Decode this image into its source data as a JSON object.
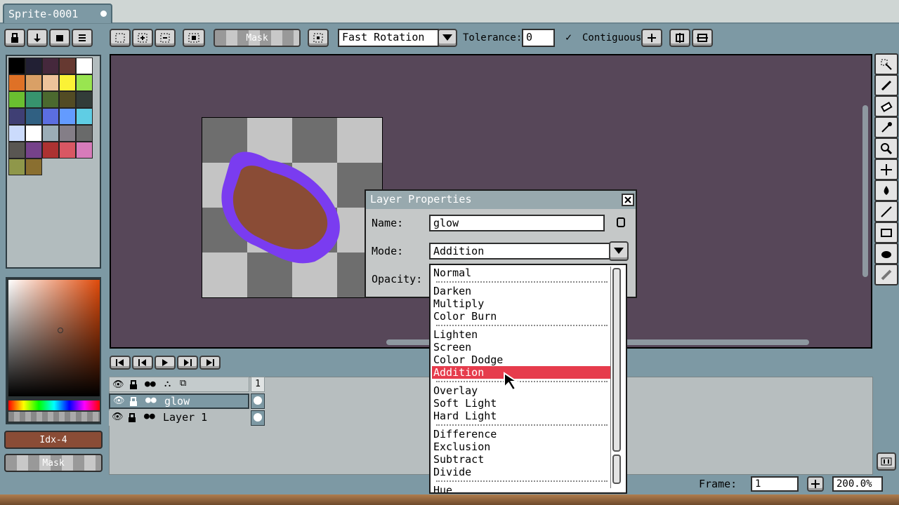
{
  "tab": {
    "title": "Sprite-0001"
  },
  "toolbar": {
    "mask_label": "Mask",
    "rotation_value": "Fast Rotation",
    "tolerance_label": "Tolerance:",
    "tolerance_value": "0",
    "continuous_label": "Contiguous"
  },
  "palette": {
    "colors": [
      "#000000",
      "#222034",
      "#45283c",
      "#663931",
      "#ffffff",
      "#df7126",
      "#d9a066",
      "#eec39a",
      "#fbf236",
      "#99e550",
      "#6abe30",
      "#37946e",
      "#4b692f",
      "#524b24",
      "#323c39",
      "#3f3f74",
      "#306082",
      "#5b6ee1",
      "#639bff",
      "#5fcde4",
      "#cbdbfc",
      "#ffffff",
      "#9badb7",
      "#847e87",
      "#696a6a",
      "#595652",
      "#76428a",
      "#ac3232",
      "#d95763",
      "#d77bba",
      "#8f974a",
      "#8a6f30"
    ]
  },
  "left": {
    "color_label": "Idx-4",
    "mask_label": "Mask",
    "fg_color": "#8a4c36"
  },
  "layers": {
    "header_frame": "1",
    "rows": [
      {
        "name": "glow"
      },
      {
        "name": "Layer 1"
      }
    ]
  },
  "dialog": {
    "title": "Layer Properties",
    "name_label": "Name:",
    "name_value": "glow",
    "mode_label": "Mode:",
    "mode_value": "Addition",
    "opacity_label": "Opacity:"
  },
  "dropdown": {
    "items": [
      "Normal",
      "Darken",
      "Multiply",
      "Color Burn",
      "Lighten",
      "Screen",
      "Color Dodge",
      "Addition",
      "Overlay",
      "Soft Light",
      "Hard Light",
      "Difference",
      "Exclusion",
      "Subtract",
      "Divide",
      "Hue"
    ],
    "selected": "Addition"
  },
  "status": {
    "frame_label": "Frame:",
    "frame_value": "1",
    "zoom_value": "200.0%"
  },
  "colors": {
    "canvas_bg": "#574759",
    "blob": "#8a4c36",
    "glow": "#7a3cf0",
    "highlight": "#e63c4c"
  }
}
